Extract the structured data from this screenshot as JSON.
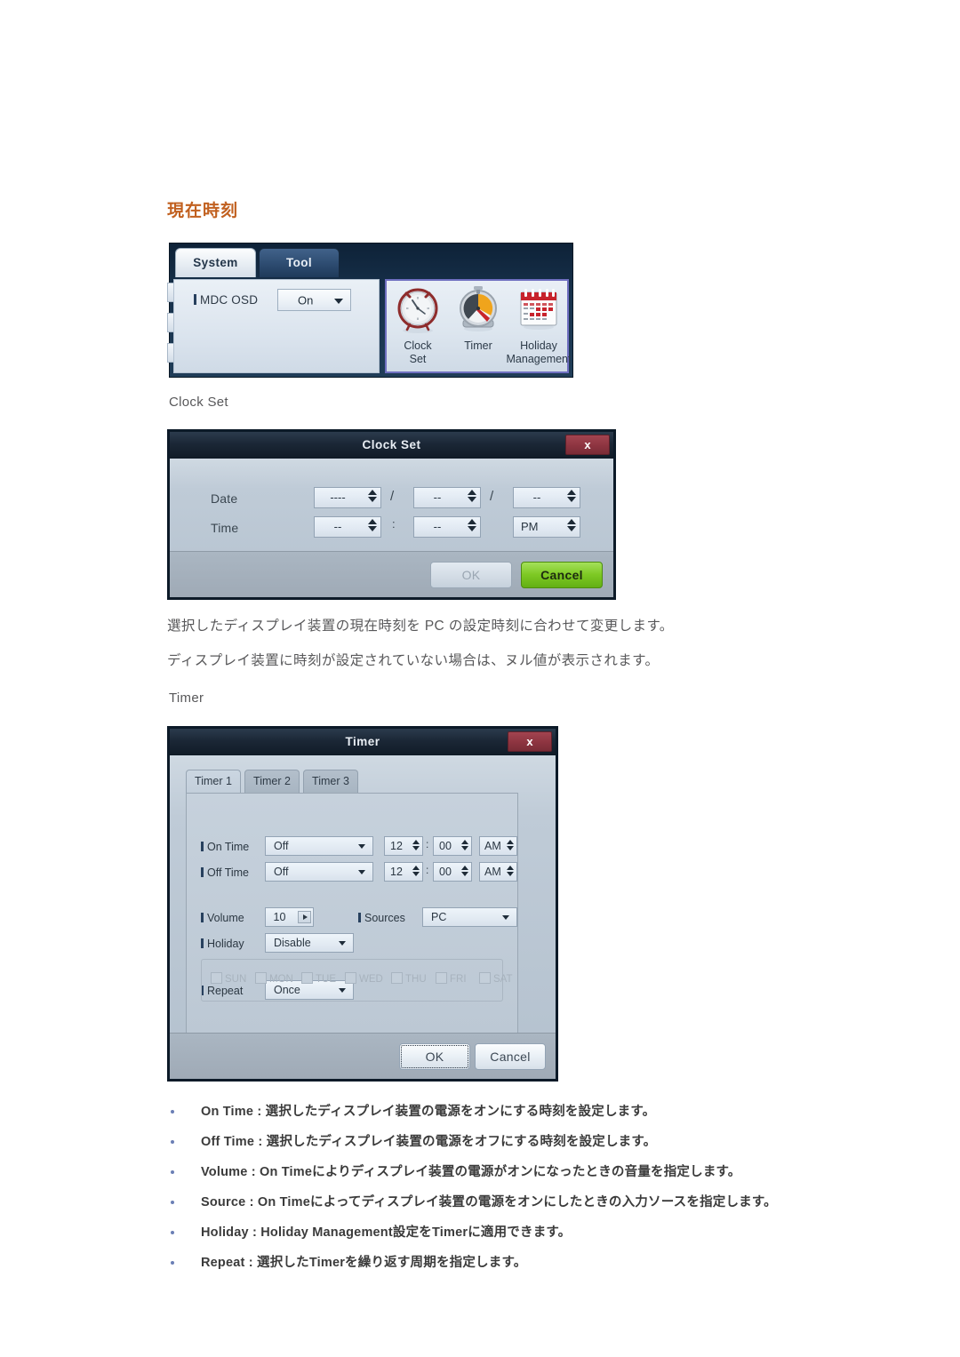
{
  "page": {
    "title": "現在時刻"
  },
  "toolbar": {
    "tabs": [
      {
        "label": "System",
        "active": true
      },
      {
        "label": "Tool",
        "active": false
      }
    ],
    "osd": {
      "label": "MDC OSD",
      "value": "On"
    },
    "icons": [
      {
        "name": "clock-set-icon",
        "line1": "Clock",
        "line2": "Set"
      },
      {
        "name": "timer-icon",
        "line1": "Timer",
        "line2": ""
      },
      {
        "name": "holiday-management-icon",
        "line1": "Holiday",
        "line2": "Management"
      }
    ],
    "selection_color": "#6f6fc0"
  },
  "clock_set": {
    "caption": "Clock Set",
    "dialog_title": "Clock Set",
    "close_label": "x",
    "date_label": "Date",
    "time_label": "Time",
    "date_year": "----",
    "date_month": "--",
    "date_day": "--",
    "date_sep1": "/",
    "date_sep2": "/",
    "time_hour": "--",
    "time_minute": "--",
    "time_meridiem": "PM",
    "time_sep": ":",
    "ok_label": "OK",
    "cancel_label": "Cancel",
    "cancel_color": "#7ec924"
  },
  "descriptions": {
    "line1": "選択したディスプレイ装置の現在時刻を PC の設定時刻に合わせて変更します。",
    "line2": "ディスプレイ装置に時刻が設定されていない場合は、ヌル値が表示されます。"
  },
  "timer": {
    "caption": "Timer",
    "dialog_title": "Timer",
    "close_label": "x",
    "tabs": [
      {
        "label": "Timer 1",
        "active": true
      },
      {
        "label": "Timer 2",
        "active": false
      },
      {
        "label": "Timer 3",
        "active": false
      }
    ],
    "fields": {
      "on_time_label": "On Time",
      "on_time_mode": "Off",
      "on_time_hour": "12",
      "on_time_minute": "00",
      "on_time_meridiem": "AM",
      "off_time_label": "Off Time",
      "off_time_mode": "Off",
      "off_time_hour": "12",
      "off_time_minute": "00",
      "off_time_meridiem": "AM",
      "volume_label": "Volume",
      "volume_value": "10",
      "sources_label": "Sources",
      "sources_value": "PC",
      "holiday_label": "Holiday",
      "holiday_value": "Disable",
      "repeat_label": "Repeat",
      "repeat_value": "Once",
      "time_sep": ":"
    },
    "days": [
      "SUN",
      "MON",
      "TUE",
      "WED",
      "THU",
      "FRI",
      "SAT"
    ],
    "ok_label": "OK",
    "cancel_label": "Cancel"
  },
  "bullets": [
    "On Time : 選択したディスプレイ装置の電源をオンにする時刻を設定します。",
    "Off Time : 選択したディスプレイ装置の電源をオフにする時刻を設定します。",
    "Volume : On Timeによりディスプレイ装置の電源がオンになったときの音量を指定します。",
    "Source : On Timeによってディスプレイ装置の電源をオンにしたときの入力ソースを指定します。",
    "Holiday : Holiday Management設定をTimerに適用できます。",
    "Repeat : 選択したTimerを繰り返す周期を指定します。"
  ]
}
